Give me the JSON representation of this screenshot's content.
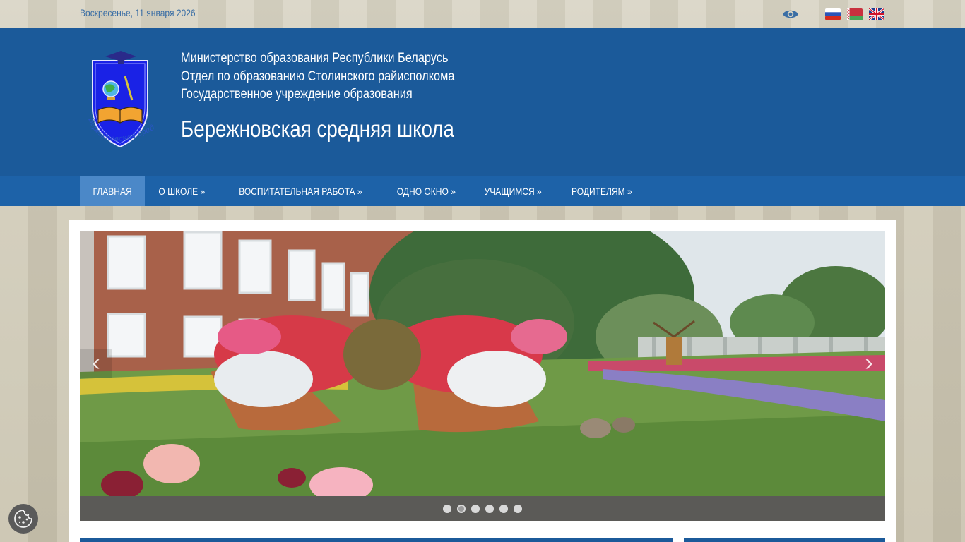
{
  "topbar": {
    "date": "Воскресенье, 11 января 2026",
    "icons": [
      "eye-icon",
      "flag-ru-icon",
      "flag-by-icon",
      "flag-en-icon"
    ]
  },
  "header": {
    "org_lines": [
      "Министерство образования Республики Беларусь",
      "Отдел по образованию Столинского райисполкома",
      "Государственное учреждение образования"
    ],
    "school_name": "Бережновская средняя школа",
    "crest_text": "Бережновская средняя школа"
  },
  "nav": {
    "items": [
      {
        "label": "ГЛАВНАЯ"
      },
      {
        "label": "О ШКОЛЕ  »"
      },
      {
        "label": "ВОСПИТАТЕЛЬНАЯ РАБОТА  »"
      },
      {
        "label": "ОДНО ОКНО  »"
      },
      {
        "label": "УЧАЩИМСЯ  »"
      },
      {
        "label": "РОДИТЕЛЯМ  »"
      }
    ],
    "active_index": 0
  },
  "slider": {
    "prev_symbol": "‹",
    "next_symbol": "›",
    "slide_count": 6,
    "active_slide": 2
  },
  "colors": {
    "header_blue": "#1b5a9a",
    "nav_blue": "#1d62a8",
    "nav_active": "#4b88c8",
    "date_text": "#3a6ea5"
  }
}
